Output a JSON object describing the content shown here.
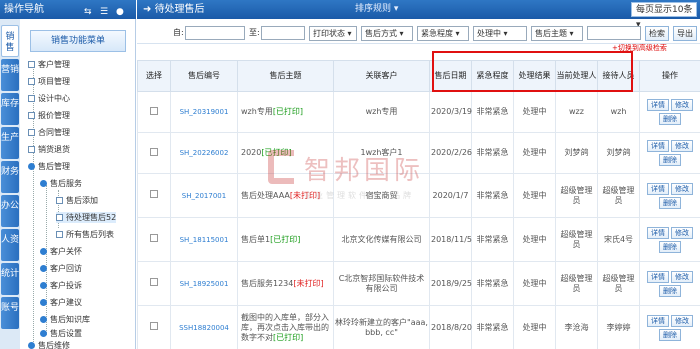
{
  "nav": {
    "title": "操作导航",
    "vtabs": [
      "销售",
      "营销",
      "库存",
      "生产",
      "财务",
      "办公",
      "人资",
      "统计",
      "账号"
    ],
    "menu_button": "销售功能菜单",
    "tree": [
      "客户管理",
      "项目管理",
      "设计中心",
      "报价管理",
      "合同管理",
      "销货退货",
      "售后管理",
      "售后服务",
      "售后添加",
      "待处理售后52",
      "所有售后列表",
      "客户关怀",
      "客户回访",
      "客户投诉",
      "客户建议",
      "售后知识库",
      "售后设置",
      "售后维修"
    ]
  },
  "header": {
    "title": "待处理售后",
    "sort_rule": "排序规则",
    "page_size": "每页显示10条"
  },
  "filters": {
    "from_label": "自:",
    "to_label": "至:",
    "print_status": "打印状态",
    "method": "售后方式",
    "urgency": "紧急程度",
    "status": "处理中",
    "subject": "售后主题",
    "search_button": "检索",
    "export_button": "导出",
    "bulk_link": "+切换到高级检索"
  },
  "table": {
    "headers": [
      "选择",
      "售后编号",
      "售后主题",
      "关联客户",
      "售后日期",
      "紧急程度",
      "处理结果",
      "当前处理人",
      "接待人员",
      "操作"
    ],
    "rows": [
      {
        "code": "SH_20319001",
        "subject": "wzh专用",
        "tag": "[已打印]",
        "tag_type": "printed",
        "customer": "wzh专用",
        "date": "2020/3/19",
        "urgency": "非常紧急",
        "result": "处理中",
        "handler": "wzz",
        "receptionist": "wzh"
      },
      {
        "code": "SH_20226002",
        "subject": "2020",
        "tag": "[已打印]",
        "tag_type": "printed",
        "customer": "1wzh客户1",
        "date": "2020/2/26",
        "urgency": "非常紧急",
        "result": "处理中",
        "handler": "刘梦鸽",
        "receptionist": "刘梦鸽"
      },
      {
        "code": "SH_2017001",
        "subject": "售后处理AAA",
        "tag": "[未打印]",
        "tag_type": "unprinted",
        "customer": "宿宝商贸",
        "date": "2020/1/7",
        "urgency": "非常紧急",
        "result": "处理中",
        "handler": "超级管理员",
        "receptionist": "超级管理员"
      },
      {
        "code": "SH_18115001",
        "subject": "售后单1",
        "tag": "[已打印]",
        "tag_type": "printed",
        "customer": "北京文化传媒有限公司",
        "date": "2018/11/5",
        "urgency": "非常紧急",
        "result": "处理中",
        "handler": "超级管理员",
        "receptionist": "宋氏4号"
      },
      {
        "code": "SH_18925001",
        "subject": "售后服务1234",
        "tag": "[未打印]",
        "tag_type": "unprinted",
        "customer": "C北京智邦国际软件技术有限公司",
        "date": "2018/9/25",
        "urgency": "非常紧急",
        "result": "处理中",
        "handler": "超级管理员",
        "receptionist": "超级管理员"
      },
      {
        "code": "SSH18820004",
        "subject": "截图中的入库单，部分入库，再次点击入库带出的数字不对",
        "tag": "[已打印]",
        "tag_type": "printed",
        "customer": "林玲玲新建立的客户\"aaa, bbb, cc\"",
        "date": "2018/8/20",
        "urgency": "非常紧急",
        "result": "处理中",
        "handler": "李沧海",
        "receptionist": "李婷婷"
      }
    ],
    "actions": {
      "detail": "详情",
      "edit": "修改",
      "delete": "删除"
    }
  },
  "watermark": {
    "name": "智邦国际",
    "sub": "企业管理软件领导品牌"
  },
  "colors": {
    "accent": "#1a5aa8",
    "highlight_box": "#e01010",
    "printed": "#1a9c1a",
    "unprinted": "#e02020"
  }
}
